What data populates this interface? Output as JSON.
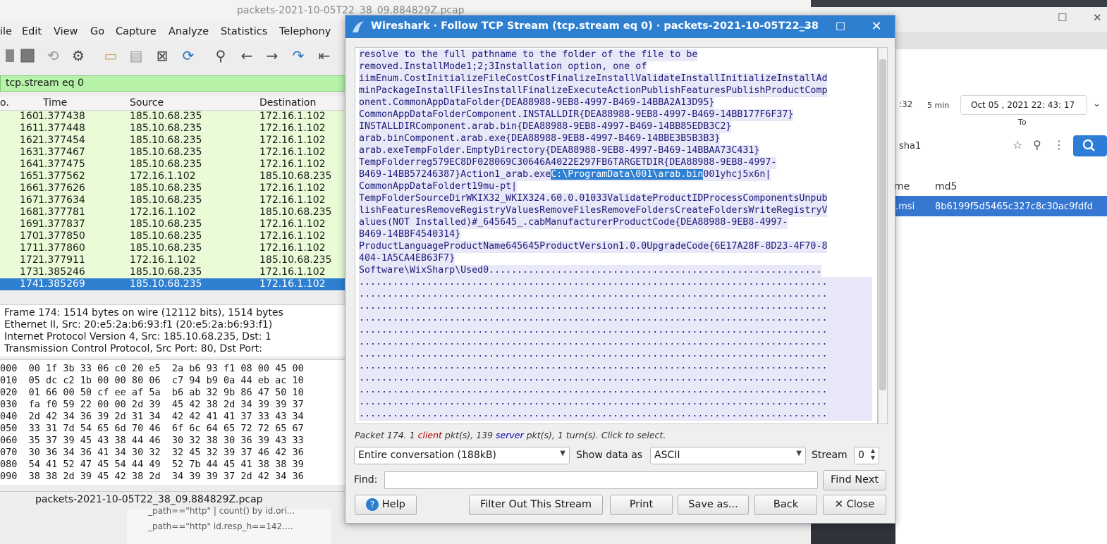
{
  "browser": {
    "chip_left": ":32",
    "chip_window": "5 min",
    "date_value": "Oct 05 , 2021 22: 43: 17",
    "to_label": "To",
    "search_field": "sha1",
    "col_name": "me",
    "col_md5": "md5",
    "row_name": ".msi",
    "row_md5": "8b6199f5d5465c327c8c30ac9fdfd"
  },
  "wireshark": {
    "title": "packets-2021-10-05T22_38_09.884829Z.pcap",
    "menu": [
      "ile",
      "Edit",
      "View",
      "Go",
      "Capture",
      "Analyze",
      "Statistics",
      "Telephony"
    ],
    "filter": "tcp.stream eq 0",
    "columns": {
      "no": "o.",
      "time": "Time",
      "source": "Source",
      "destination": "Destination"
    },
    "packets": [
      {
        "no": "160",
        "time": "1.377438",
        "src": "185.10.68.235",
        "dst": "172.16.1.102"
      },
      {
        "no": "161",
        "time": "1.377448",
        "src": "185.10.68.235",
        "dst": "172.16.1.102"
      },
      {
        "no": "162",
        "time": "1.377454",
        "src": "185.10.68.235",
        "dst": "172.16.1.102"
      },
      {
        "no": "163",
        "time": "1.377467",
        "src": "185.10.68.235",
        "dst": "172.16.1.102"
      },
      {
        "no": "164",
        "time": "1.377475",
        "src": "185.10.68.235",
        "dst": "172.16.1.102"
      },
      {
        "no": "165",
        "time": "1.377562",
        "src": "172.16.1.102",
        "dst": "185.10.68.235"
      },
      {
        "no": "166",
        "time": "1.377626",
        "src": "185.10.68.235",
        "dst": "172.16.1.102"
      },
      {
        "no": "167",
        "time": "1.377634",
        "src": "185.10.68.235",
        "dst": "172.16.1.102"
      },
      {
        "no": "168",
        "time": "1.377781",
        "src": "172.16.1.102",
        "dst": "185.10.68.235"
      },
      {
        "no": "169",
        "time": "1.377837",
        "src": "185.10.68.235",
        "dst": "172.16.1.102"
      },
      {
        "no": "170",
        "time": "1.377850",
        "src": "185.10.68.235",
        "dst": "172.16.1.102"
      },
      {
        "no": "171",
        "time": "1.377860",
        "src": "185.10.68.235",
        "dst": "172.16.1.102"
      },
      {
        "no": "172",
        "time": "1.377911",
        "src": "172.16.1.102",
        "dst": "185.10.68.235"
      },
      {
        "no": "173",
        "time": "1.385246",
        "src": "185.10.68.235",
        "dst": "172.16.1.102"
      },
      {
        "no": "174",
        "time": "1.385269",
        "src": "185.10.68.235",
        "dst": "172.16.1.102"
      }
    ],
    "details": [
      "Frame 174: 1514 bytes on wire (12112 bits), 1514 bytes",
      "Ethernet II, Src: 20:e5:2a:b6:93:f1 (20:e5:2a:b6:93:f1)",
      "Internet Protocol Version 4, Src: 185.10.68.235, Dst: 1",
      "Transmission Control Protocol, Src Port: 80, Dst Port:"
    ],
    "hex": [
      "000  00 1f 3b 33 06 c0 20 e5  2a b6 93 f1 08 00 45 00",
      "010  05 dc c2 1b 00 00 80 06  c7 94 b9 0a 44 eb ac 10",
      "020  01 66 00 50 cf ee af 5a  b6 ab 32 9b 86 47 50 10",
      "030  fa f0 59 22 00 00 2d 39  45 42 38 2d 34 39 39 37",
      "040  2d 42 34 36 39 2d 31 34  42 42 41 41 37 33 43 34",
      "050  33 31 7d 54 65 6d 70 46  6f 6c 64 65 72 72 65 67",
      "060  35 37 39 45 43 38 44 46  30 32 38 30 36 39 43 33",
      "070  30 36 34 36 41 34 30 32  32 45 32 39 37 46 42 36",
      "080  54 41 52 47 45 54 44 49  52 7b 44 45 41 38 38 39",
      "090  38 38 2d 39 45 42 38 2d  34 39 39 37 2d 42 34 36"
    ],
    "status_file": "packets-2021-10-05T22_38_09.884829Z.pcap",
    "below_lines": [
      "_path==\"http\" | count() by id.ori...",
      "_path==\"http\" id.resp_h==142...."
    ]
  },
  "dialog": {
    "title": "Wireshark · Follow TCP Stream (tcp.stream eq 0) · packets-2021-10-05T22_38",
    "stream_lines": [
      "resolve to the full pathname to the folder of the file to be",
      "removed.InstallMode1;2;3Installation option, one of",
      "iimEnum.CostInitializeFileCostCostFinalizeInstallValidateInstallInitializeInstallAd",
      "minPackageInstallFilesInstallFinalizeExecuteActionPublishFeaturesPublishProductComp",
      "onent.CommonAppDataFolder{DEA88988-9EB8-4997-B469-14BBA2A13D95}",
      "CommonAppDataFolderComponent.INSTALLDIR{DEA88988-9EB8-4997-B469-14BB177F6F37}",
      "INSTALLDIRComponent.arab.bin{DEA88988-9EB8-4997-B469-14BB85EDB3C2}",
      "arab.binComponent.arab.exe{DEA88988-9EB8-4997-B469-14BBE3B5B3B3}",
      "arab.exeTempFolder.EmptyDirectory{DEA88988-9EB8-4997-B469-14BBAA73C431}",
      "TempFolderreg579EC8DF028069C30646A4022E297FB6TARGETDIR{DEA88988-9EB8-4997-"
    ],
    "line11_pre": "B469-14BB57246387}Action1_arab.exe",
    "line11_sel": "C:\\ProgramData\\001\\arab.bin",
    "line11_post": "001yhcj5x6n|",
    "stream_lines_b": [
      "CommonAppDataFoldert19mu-pt|",
      "TempFolderSourceDirWKIX32_WKIX324.60.0.01033ValidateProductIDProcessComponentsUnpub",
      "lishFeaturesRemoveRegistryValuesRemoveFilesRemoveFoldersCreateFoldersWriteRegistryV",
      "alues(NOT Installed)#_645645_.cabManufacturerProductCode{DEA88988-9EB8-4997-",
      "B469-14BBF4540314}",
      "ProductLanguageProductName645645ProductVersion1.0.0UpgradeCode{6E17A28F-8D23-4F70-8",
      "404-1A5CA4EB63F7}",
      "Software\\WixSharp\\Used0..........................................................."
    ],
    "dot_line": "...................................................................................",
    "stats_packet": "Packet 174. 1 ",
    "stats_client": "client",
    "stats_mid": " pkt(s), 139 ",
    "stats_server": "server",
    "stats_end": " pkt(s), 1 turn(s). Click to select.",
    "conversation": "Entire conversation (188kB)",
    "show_data_label": "Show data as",
    "show_data_value": "ASCII",
    "stream_label": "Stream",
    "stream_value": "0",
    "find_label": "Find:",
    "find_value": "",
    "buttons": {
      "find_next": "Find Next",
      "help": "Help",
      "filter_out": "Filter Out This Stream",
      "print": "Print",
      "save_as": "Save as...",
      "back": "Back",
      "close": "Close"
    }
  }
}
